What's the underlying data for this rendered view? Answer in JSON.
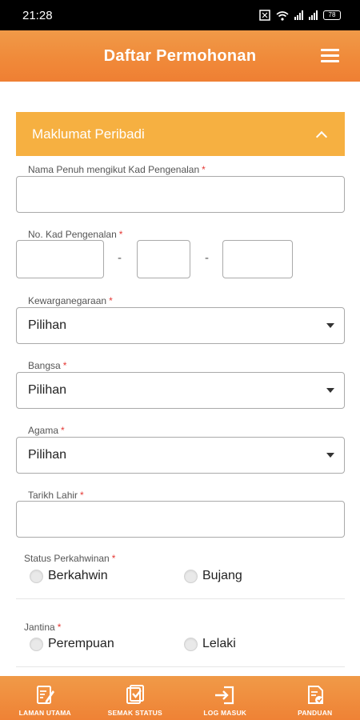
{
  "status_bar": {
    "time": "21:28",
    "battery": "78"
  },
  "header": {
    "title": "Daftar Permohonan"
  },
  "section": {
    "title": "Maklumat Peribadi"
  },
  "fields": {
    "full_name": {
      "label": "Nama Penuh mengikut Kad Pengenalan",
      "required": "*",
      "value": ""
    },
    "ic_number": {
      "label": "No. Kad Pengenalan",
      "required": "*",
      "separator": "-"
    },
    "citizenship": {
      "label": "Kewarganegaraan",
      "required": "*",
      "value": "Pilihan"
    },
    "race": {
      "label": "Bangsa",
      "required": "*",
      "value": "Pilihan"
    },
    "religion": {
      "label": "Agama",
      "required": "*",
      "value": "Pilihan"
    },
    "birth_date": {
      "label": "Tarikh Lahir",
      "required": "*",
      "value": ""
    },
    "marital_status": {
      "label": "Status Perkahwinan",
      "required": "*",
      "options": [
        "Berkahwin",
        "Bujang"
      ]
    },
    "gender": {
      "label": "Jantina",
      "required": "*",
      "options": [
        "Perempuan",
        "Lelaki"
      ]
    }
  },
  "bottom_nav": [
    {
      "label": "LAMAN UTAMA",
      "icon": "edit-document-icon"
    },
    {
      "label": "SEMAK STATUS",
      "icon": "checklist-icon"
    },
    {
      "label": "LOG MASUK",
      "icon": "login-icon"
    },
    {
      "label": "PANDUAN",
      "icon": "guide-document-icon"
    }
  ],
  "colors": {
    "header": "#ef8a3a",
    "section_header": "#f6b041",
    "required": "#e53935"
  }
}
